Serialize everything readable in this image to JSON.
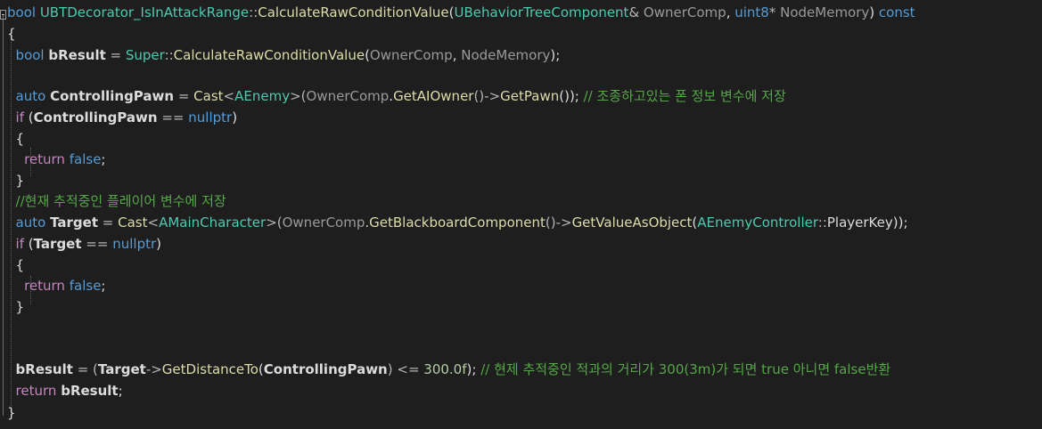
{
  "lines": [
    [
      {
        "t": "bool",
        "c": "kw"
      },
      {
        "t": " ",
        "c": "id"
      },
      {
        "t": "UBTDecorator_IsInAttackRange",
        "c": "ty"
      },
      {
        "t": "::",
        "c": "op"
      },
      {
        "t": "CalculateRawConditionValue",
        "c": "fn"
      },
      {
        "t": "(",
        "c": "id"
      },
      {
        "t": "UBehaviorTreeComponent",
        "c": "ty"
      },
      {
        "t": "& ",
        "c": "op"
      },
      {
        "t": "OwnerComp",
        "c": "pm"
      },
      {
        "t": ", ",
        "c": "id"
      },
      {
        "t": "uint8",
        "c": "kw"
      },
      {
        "t": "* ",
        "c": "op"
      },
      {
        "t": "NodeMemory",
        "c": "pm"
      },
      {
        "t": ") ",
        "c": "id"
      },
      {
        "t": "const",
        "c": "kw"
      }
    ],
    [
      {
        "t": "{",
        "c": "id"
      }
    ],
    [
      {
        "t": "  ",
        "c": "id"
      },
      {
        "t": "bool",
        "c": "kw"
      },
      {
        "t": " ",
        "c": "id"
      },
      {
        "t": "bResult",
        "c": "id bold"
      },
      {
        "t": " = ",
        "c": "op"
      },
      {
        "t": "Super",
        "c": "ty"
      },
      {
        "t": "::",
        "c": "op"
      },
      {
        "t": "CalculateRawConditionValue",
        "c": "fn"
      },
      {
        "t": "(",
        "c": "id"
      },
      {
        "t": "OwnerComp",
        "c": "pm"
      },
      {
        "t": ", ",
        "c": "id"
      },
      {
        "t": "NodeMemory",
        "c": "pm"
      },
      {
        "t": ");",
        "c": "id"
      }
    ],
    [],
    [
      {
        "t": "  ",
        "c": "id"
      },
      {
        "t": "auto",
        "c": "kw"
      },
      {
        "t": " ",
        "c": "id"
      },
      {
        "t": "ControllingPawn",
        "c": "id bold"
      },
      {
        "t": " = ",
        "c": "op"
      },
      {
        "t": "Cast",
        "c": "fn"
      },
      {
        "t": "<",
        "c": "op"
      },
      {
        "t": "AEnemy",
        "c": "ty"
      },
      {
        "t": ">(",
        "c": "op"
      },
      {
        "t": "OwnerComp",
        "c": "pm"
      },
      {
        "t": ".",
        "c": "id"
      },
      {
        "t": "GetAIOwner",
        "c": "fn"
      },
      {
        "t": "()->",
        "c": "op"
      },
      {
        "t": "GetPawn",
        "c": "fn"
      },
      {
        "t": "()); ",
        "c": "id"
      },
      {
        "t": "// 조종하고있는 폰 정보 변수에 저장",
        "c": "cm"
      }
    ],
    [
      {
        "t": "  ",
        "c": "id"
      },
      {
        "t": "if",
        "c": "ct"
      },
      {
        "t": " (",
        "c": "id"
      },
      {
        "t": "ControllingPawn",
        "c": "id bold"
      },
      {
        "t": " == ",
        "c": "op"
      },
      {
        "t": "nullptr",
        "c": "kw"
      },
      {
        "t": ")",
        "c": "id"
      }
    ],
    [
      {
        "t": "  {",
        "c": "id"
      }
    ],
    [
      {
        "t": "    ",
        "c": "id"
      },
      {
        "t": "return",
        "c": "ct"
      },
      {
        "t": " ",
        "c": "id"
      },
      {
        "t": "false",
        "c": "kw"
      },
      {
        "t": ";",
        "c": "id"
      }
    ],
    [
      {
        "t": "  }",
        "c": "id"
      }
    ],
    [
      {
        "t": "  ",
        "c": "id"
      },
      {
        "t": "//현재 추적중인 플레이어 변수에 저장",
        "c": "cm"
      }
    ],
    [
      {
        "t": "  ",
        "c": "id"
      },
      {
        "t": "auto",
        "c": "kw"
      },
      {
        "t": " ",
        "c": "id"
      },
      {
        "t": "Target",
        "c": "id bold"
      },
      {
        "t": " = ",
        "c": "op"
      },
      {
        "t": "Cast",
        "c": "fn"
      },
      {
        "t": "<",
        "c": "op"
      },
      {
        "t": "AMainCharacter",
        "c": "ty"
      },
      {
        "t": ">(",
        "c": "op"
      },
      {
        "t": "OwnerComp",
        "c": "pm"
      },
      {
        "t": ".",
        "c": "id"
      },
      {
        "t": "GetBlackboardComponent",
        "c": "fn"
      },
      {
        "t": "()->",
        "c": "op"
      },
      {
        "t": "GetValueAsObject",
        "c": "fn"
      },
      {
        "t": "(",
        "c": "id"
      },
      {
        "t": "AEnemyController",
        "c": "ty"
      },
      {
        "t": "::",
        "c": "op"
      },
      {
        "t": "PlayerKey",
        "c": "id"
      },
      {
        "t": "));",
        "c": "id"
      }
    ],
    [
      {
        "t": "  ",
        "c": "id"
      },
      {
        "t": "if",
        "c": "ct"
      },
      {
        "t": " (",
        "c": "id"
      },
      {
        "t": "Target",
        "c": "id bold"
      },
      {
        "t": " == ",
        "c": "op"
      },
      {
        "t": "nullptr",
        "c": "kw"
      },
      {
        "t": ")",
        "c": "id"
      }
    ],
    [
      {
        "t": "  {",
        "c": "id"
      }
    ],
    [
      {
        "t": "    ",
        "c": "id"
      },
      {
        "t": "return",
        "c": "ct"
      },
      {
        "t": " ",
        "c": "id"
      },
      {
        "t": "false",
        "c": "kw"
      },
      {
        "t": ";",
        "c": "id"
      }
    ],
    [
      {
        "t": "  }",
        "c": "id"
      }
    ],
    [],
    [],
    [
      {
        "t": "  ",
        "c": "id"
      },
      {
        "t": "bResult",
        "c": "id bold"
      },
      {
        "t": " = (",
        "c": "op"
      },
      {
        "t": "Target",
        "c": "id bold"
      },
      {
        "t": "->",
        "c": "op"
      },
      {
        "t": "GetDistanceTo",
        "c": "fn"
      },
      {
        "t": "(",
        "c": "id"
      },
      {
        "t": "ControllingPawn",
        "c": "id bold"
      },
      {
        "t": ") <= ",
        "c": "op"
      },
      {
        "t": "300.0f",
        "c": "nu"
      },
      {
        "t": "); ",
        "c": "id"
      },
      {
        "t": "// 현제 추적중인 적과의 거리가 300(3m)가 되면 true 아니면 false반환",
        "c": "cm"
      }
    ],
    [
      {
        "t": "  ",
        "c": "id"
      },
      {
        "t": "return",
        "c": "ct"
      },
      {
        "t": " ",
        "c": "id"
      },
      {
        "t": "bResult",
        "c": "id bold"
      },
      {
        "t": ";",
        "c": "id"
      }
    ],
    [
      {
        "t": "}",
        "c": "id"
      }
    ]
  ]
}
